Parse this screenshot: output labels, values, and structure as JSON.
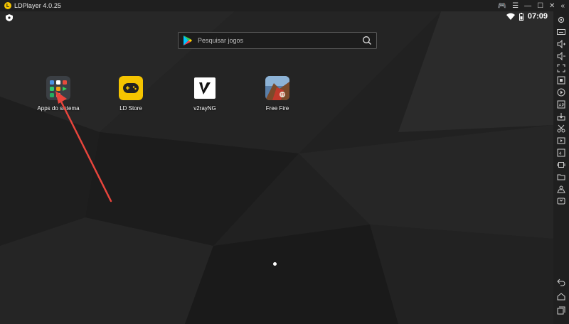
{
  "window": {
    "title": "LDPlayer 4.0.25",
    "logo_letter": "LD"
  },
  "status": {
    "time": "07:09"
  },
  "search": {
    "placeholder": "Pesquisar jogos"
  },
  "apps": [
    {
      "label": "Apps do sistema"
    },
    {
      "label": "LD Store"
    },
    {
      "label": "v2rayNG"
    },
    {
      "label": "Free Fire"
    }
  ],
  "colors": {
    "accent": "#f5c400",
    "arrow": "#e8453c",
    "background": "#1b1b1b"
  }
}
